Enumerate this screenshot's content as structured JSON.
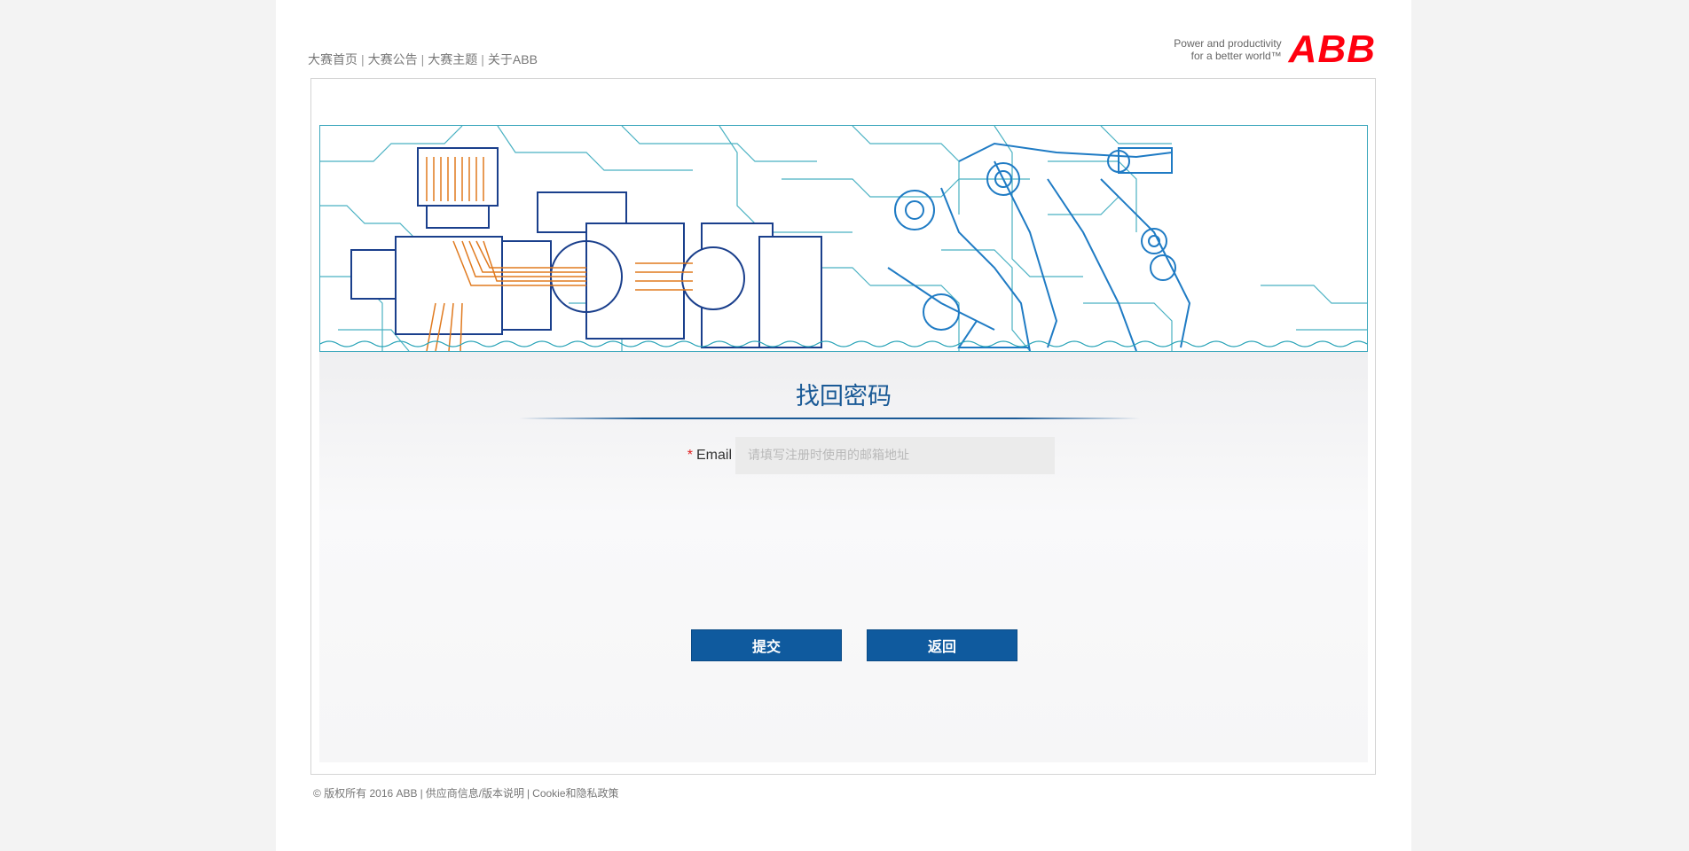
{
  "nav": {
    "items": [
      {
        "label": "大赛首页"
      },
      {
        "label": "大赛公告"
      },
      {
        "label": "大赛主题"
      },
      {
        "label": "关于ABB"
      }
    ],
    "separator": "|"
  },
  "brand": {
    "tagline_line1": "Power and productivity",
    "tagline_line2": "for a better world™",
    "logo_text": "ABB",
    "logo_color": "#ff000f"
  },
  "form": {
    "title": "找回密码",
    "email_label": "Email",
    "required_mark": "*",
    "email_value": "",
    "email_placeholder": "请填写注册时使用的邮箱地址",
    "submit_label": "提交",
    "back_label": "返回"
  },
  "footer": {
    "copyright": "© 版权所有 2016 ABB",
    "links": [
      {
        "label": "供应商信息/版本说明"
      },
      {
        "label": "Cookie和隐私政策"
      }
    ],
    "separator": "|"
  },
  "colors": {
    "accent": "#0f5a9e",
    "title": "#1a5a96",
    "banner_line": "#2aa4b8",
    "banner_orange": "#e07a1f"
  }
}
